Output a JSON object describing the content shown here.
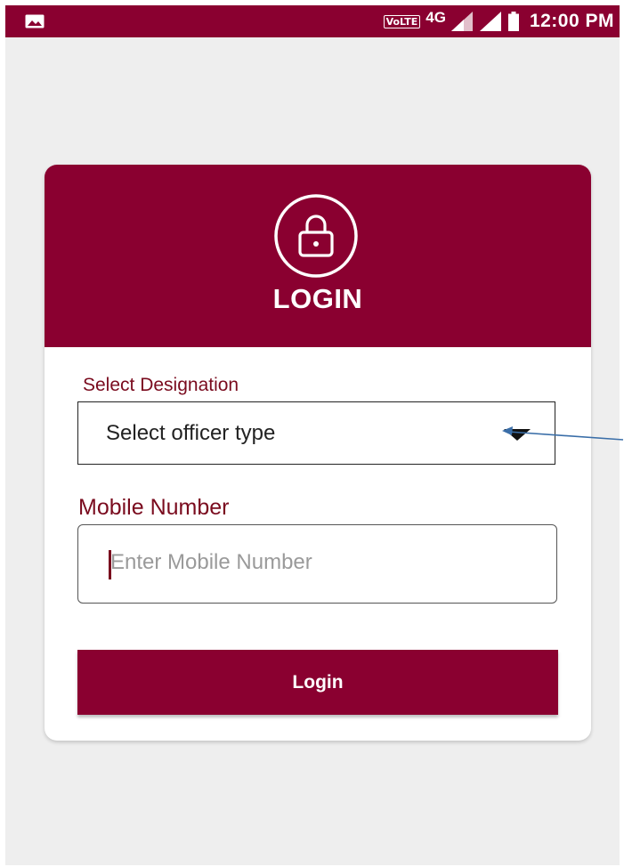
{
  "status_bar": {
    "left_icon": "image-icon",
    "volte": "VoLTE",
    "network": "4G",
    "time": "12:00 PM",
    "signal_icon": "signal-icon",
    "battery_icon": "battery-icon"
  },
  "card": {
    "icon": "lock-icon",
    "title": "LOGIN"
  },
  "designation": {
    "label": "Select Designation",
    "selected": "Select officer type",
    "arrow_icon": "chevron-down-icon"
  },
  "mobile": {
    "label": "Mobile Number",
    "placeholder": "Enter Mobile Number",
    "value": ""
  },
  "login_button": {
    "label": "Login"
  },
  "colors": {
    "brand": "#8a0030",
    "label_text": "#7a0b1e",
    "background": "#eeeeee",
    "annotation_arrow": "#3a6ea8"
  }
}
